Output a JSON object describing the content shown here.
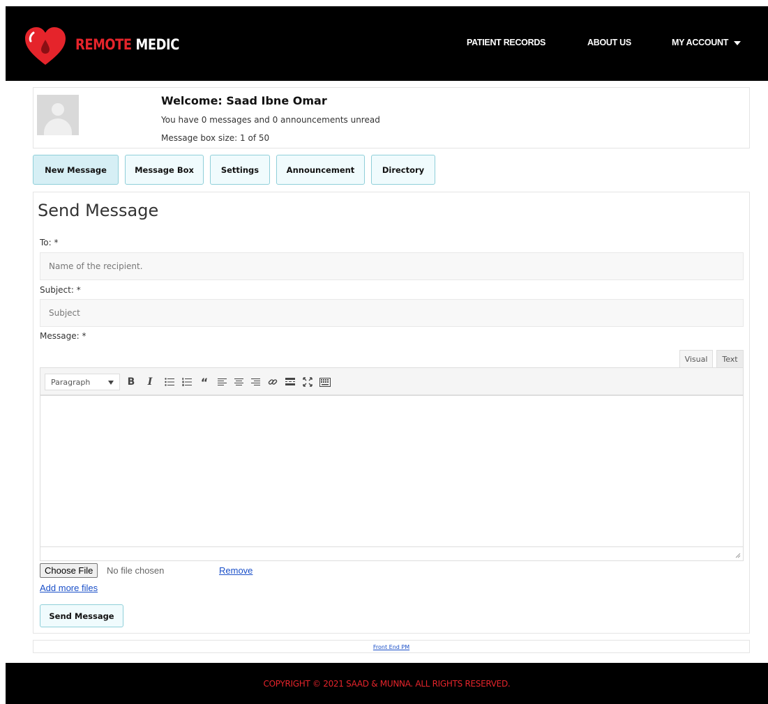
{
  "brand": {
    "name_part1": "REMOTE",
    "name_part2": " MEDIC",
    "accent_color": "#e5242b"
  },
  "nav": {
    "items": [
      {
        "label": "PATIENT RECORDS"
      },
      {
        "label": "ABOUT US"
      },
      {
        "label": "MY ACCOUNT"
      }
    ]
  },
  "welcome": {
    "title": "Welcome: Saad Ibne Omar",
    "unread": "You have 0 messages and 0 announcements unread",
    "box_size": "Message box size: 1 of 50"
  },
  "tabs": [
    {
      "label": "New Message",
      "active": true
    },
    {
      "label": "Message Box"
    },
    {
      "label": "Settings"
    },
    {
      "label": "Announcement"
    },
    {
      "label": "Directory"
    }
  ],
  "form": {
    "title": "Send Message",
    "to_label": "To: *",
    "to_placeholder": "Name of the recipient.",
    "subject_label": "Subject: *",
    "subject_placeholder": "Subject",
    "message_label": "Message: *",
    "mode_visual": "Visual",
    "mode_text": "Text",
    "format_select": "Paragraph",
    "toolbar_icons": [
      "bold-icon",
      "italic-icon",
      "bullet-list-icon",
      "numbered-list-icon",
      "blockquote-icon",
      "align-left-icon",
      "align-center-icon",
      "align-right-icon",
      "link-icon",
      "read-more-icon",
      "fullscreen-icon",
      "toolbar-toggle-icon"
    ],
    "file_button": "Choose File",
    "file_status": "No file chosen",
    "remove_link": "Remove",
    "add_files_link": "Add more files",
    "send_button": "Send Message"
  },
  "credit": {
    "link": "Front End PM"
  },
  "footer": {
    "copyright": "COPYRIGHT © 2021 SAAD & MUNNA. ALL RIGHTS RESERVED."
  }
}
